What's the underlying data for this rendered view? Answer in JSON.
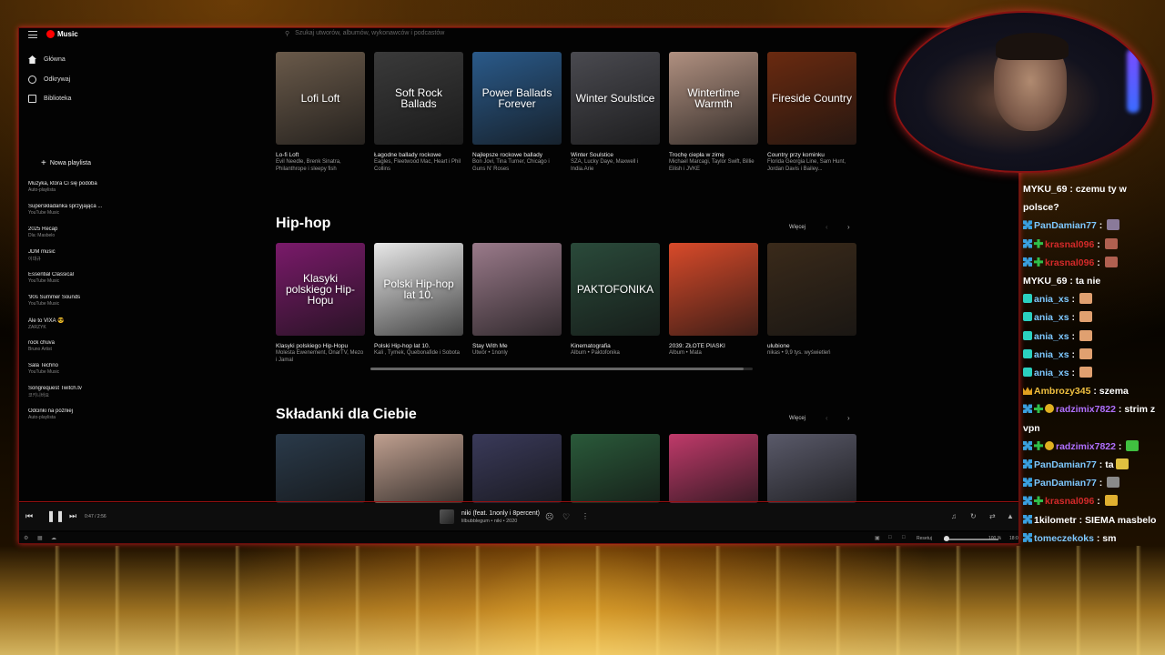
{
  "app": {
    "logo_label": "Music",
    "search_placeholder": "Szukaj utworów, albumów, wykonawców i podcastów"
  },
  "sidebar": {
    "nav": [
      {
        "label": "Główna",
        "icon": "home-icon"
      },
      {
        "label": "Odkrywaj",
        "icon": "explore-icon"
      },
      {
        "label": "Biblioteka",
        "icon": "library-icon"
      }
    ],
    "new_playlist": "Nowa playlista",
    "playlists": [
      {
        "title": "Muzyka, która Ci się podoba",
        "sub": "Auto-playlista"
      },
      {
        "title": "Superskładanka sprzyjająca ...",
        "sub": "YouTube Music"
      },
      {
        "title": "2025 Recap",
        "sub": "Dla: Masbelo"
      },
      {
        "title": "JDM music",
        "sub": "이대규"
      },
      {
        "title": "Essential Classical",
        "sub": "YouTube Music"
      },
      {
        "title": "'90s Summer Sounds",
        "sub": "YouTube Music"
      },
      {
        "title": "Ale to VIXA 😎",
        "sub": "ZARZYK"
      },
      {
        "title": "rock chuva",
        "sub": "Bruno Artist"
      },
      {
        "title": "Sala Techno",
        "sub": "YouTube Music"
      },
      {
        "title": "Songrequest Twitch.tv",
        "sub": "코키니바요"
      },
      {
        "title": "Odcinki na później",
        "sub": "Auto-playlista"
      }
    ]
  },
  "row1": [
    {
      "thumb_text": "Lofi Loft",
      "title": "Lo-fi Loft",
      "sub": "Evil Needle, Brenk Sinatra, Philanthrope i sleepy fish",
      "bg": "#6a5a4a"
    },
    {
      "thumb_text": "Soft Rock Ballads",
      "title": "Łagodne ballady rockowe",
      "sub": "Eagles, Fleetwood Mac, Heart i Phil Collins",
      "bg": "#3a3a3a"
    },
    {
      "thumb_text": "Power Ballads Forever",
      "title": "Najlepsze rockowe ballady",
      "sub": "Bon Jovi, Tina Turner, Chicago i Guns N' Roses",
      "bg": "#2a5a8a"
    },
    {
      "thumb_text": "Winter Soulstice",
      "title": "Winter Soulstice",
      "sub": "SZA, Lucky Daye, Maxwell i India.Arie",
      "bg": "#4a4a50"
    },
    {
      "thumb_text": "Wintertime Warmth",
      "title": "Trochę ciepła w zimę",
      "sub": "Michael Marcagi, Taylor Swift, Billie Eilish i JVKE",
      "bg": "#b09080"
    },
    {
      "thumb_text": "Fireside Country",
      "title": "Country przy kominku",
      "sub": "Florida Georgia Line, Sam Hunt, Jordan Davis i Bailey...",
      "bg": "#6a2a10"
    }
  ],
  "hiphop": {
    "title": "Hip-hop",
    "more": "Więcej",
    "cards": [
      {
        "thumb_text": "Klasyki polskiego Hip-Hopu",
        "title": "Klasyki polskiego Hip-Hopu",
        "sub": "Molesta Ewenement, OnarTV, Mezo i Jamal",
        "bg": "#7a1a6a"
      },
      {
        "thumb_text": "Polski Hip-hop lat 10.",
        "title": "Polski Hip-hop lat 10.",
        "sub": "Kali , Tymek, Quebonafide i Sobota",
        "bg": "#e8e8e8"
      },
      {
        "thumb_text": "",
        "title": "Stay With Me",
        "sub": "Utwór • 1nonly",
        "bg": "#9a7a8a"
      },
      {
        "thumb_text": "PAKTOFONIKA",
        "title": "Kinematografia",
        "sub": "Album • Paktofonika",
        "bg": "#2a4a3a"
      },
      {
        "thumb_text": "",
        "title": "2039: ZŁOTE PIASKI",
        "sub": "Album • Mata",
        "bg": "#d84a2a"
      },
      {
        "thumb_text": "",
        "title": "ulubione",
        "sub": "nikas • 9,9 tys. wyświetleń",
        "bg": "#3a2a1a"
      }
    ]
  },
  "mixes": {
    "title": "Składanki dla Ciebie",
    "more": "Więcej",
    "cards": [
      {
        "bg": "#2a3a4a"
      },
      {
        "bg": "#c0a090"
      },
      {
        "bg": "#3a3a5a"
      },
      {
        "bg": "#2a5a3a"
      },
      {
        "bg": "#c03a6a"
      },
      {
        "bg": "#5a5a6a"
      }
    ]
  },
  "player": {
    "time": "0:47 / 2:56",
    "title": "niki (feat. 1nonly i 8percent)",
    "sub": "lilbubblegum • niki • 2020"
  },
  "statusbar": {
    "reset": "Resetuj",
    "zoom": "100 %",
    "extra": "18:0"
  },
  "chat": [
    {
      "user": "MYKU_69",
      "color": "#ffffff",
      "msg": "czemu ty w polsce?",
      "badges": [],
      "wrap": true
    },
    {
      "user": "PanDamian77",
      "color": "#7ec8ff",
      "msg": "",
      "badges": [
        "blue"
      ],
      "emote": "#8a7a9a"
    },
    {
      "user": "krasnal096",
      "color": "#d42a2a",
      "msg": "",
      "badges": [
        "blue",
        "green"
      ],
      "emote": "#b06050"
    },
    {
      "user": "krasnal096",
      "color": "#d42a2a",
      "msg": "",
      "badges": [
        "blue",
        "green"
      ],
      "emote": "#b06050"
    },
    {
      "user": "MYKU_69",
      "color": "#ffffff",
      "msg": "ta nie",
      "badges": []
    },
    {
      "user": "ania_xs",
      "color": "#7ec8ff",
      "msg": "",
      "badges": [
        "sub"
      ],
      "emote": "#e0a070"
    },
    {
      "user": "ania_xs",
      "color": "#7ec8ff",
      "msg": "",
      "badges": [
        "sub"
      ],
      "emote": "#e0a070"
    },
    {
      "user": "ania_xs",
      "color": "#7ec8ff",
      "msg": "",
      "badges": [
        "sub"
      ],
      "emote": "#e0a070"
    },
    {
      "user": "ania_xs",
      "color": "#7ec8ff",
      "msg": "",
      "badges": [
        "sub"
      ],
      "emote": "#e0a070"
    },
    {
      "user": "ania_xs",
      "color": "#7ec8ff",
      "msg": "",
      "badges": [
        "sub"
      ],
      "emote": "#e0a070"
    },
    {
      "user": "Ambrozy345",
      "color": "#f0c040",
      "msg": "szema",
      "badges": [
        "crown"
      ]
    },
    {
      "user": "radzimix7822",
      "color": "#b070ff",
      "msg": "strim z vpn",
      "badges": [
        "blue",
        "green",
        "gold"
      ],
      "wrap": true
    },
    {
      "user": "radzimix7822",
      "color": "#b070ff",
      "msg": "",
      "badges": [
        "blue",
        "green",
        "gold"
      ],
      "emote": "#40c040"
    },
    {
      "user": "PanDamian77",
      "color": "#7ec8ff",
      "msg": "ta",
      "badges": [
        "blue"
      ],
      "emote": "#e0c040"
    },
    {
      "user": "PanDamian77",
      "color": "#7ec8ff",
      "msg": "",
      "badges": [
        "blue"
      ],
      "emote": "#8a8a8a"
    },
    {
      "user": "krasnal096",
      "color": "#d42a2a",
      "msg": "",
      "badges": [
        "blue",
        "green"
      ],
      "emote": "#e0b030"
    },
    {
      "user": "1kilometr",
      "color": "#ffffff",
      "msg": "SIEMA masbelo",
      "badges": [
        "blue"
      ],
      "wrap": true
    },
    {
      "user": "tomeczekoks",
      "color": "#7ec8ff",
      "msg": "sm",
      "badges": [
        "blue"
      ]
    }
  ]
}
